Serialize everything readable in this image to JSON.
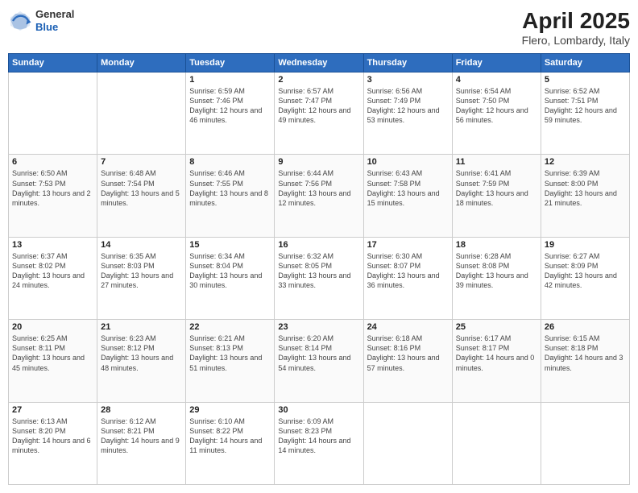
{
  "header": {
    "logo_general": "General",
    "logo_blue": "Blue",
    "title": "April 2025",
    "location": "Flero, Lombardy, Italy"
  },
  "days_of_week": [
    "Sunday",
    "Monday",
    "Tuesday",
    "Wednesday",
    "Thursday",
    "Friday",
    "Saturday"
  ],
  "weeks": [
    [
      {
        "day": null
      },
      {
        "day": null
      },
      {
        "day": "1",
        "sunrise": "Sunrise: 6:59 AM",
        "sunset": "Sunset: 7:46 PM",
        "daylight": "Daylight: 12 hours and 46 minutes."
      },
      {
        "day": "2",
        "sunrise": "Sunrise: 6:57 AM",
        "sunset": "Sunset: 7:47 PM",
        "daylight": "Daylight: 12 hours and 49 minutes."
      },
      {
        "day": "3",
        "sunrise": "Sunrise: 6:56 AM",
        "sunset": "Sunset: 7:49 PM",
        "daylight": "Daylight: 12 hours and 53 minutes."
      },
      {
        "day": "4",
        "sunrise": "Sunrise: 6:54 AM",
        "sunset": "Sunset: 7:50 PM",
        "daylight": "Daylight: 12 hours and 56 minutes."
      },
      {
        "day": "5",
        "sunrise": "Sunrise: 6:52 AM",
        "sunset": "Sunset: 7:51 PM",
        "daylight": "Daylight: 12 hours and 59 minutes."
      }
    ],
    [
      {
        "day": "6",
        "sunrise": "Sunrise: 6:50 AM",
        "sunset": "Sunset: 7:53 PM",
        "daylight": "Daylight: 13 hours and 2 minutes."
      },
      {
        "day": "7",
        "sunrise": "Sunrise: 6:48 AM",
        "sunset": "Sunset: 7:54 PM",
        "daylight": "Daylight: 13 hours and 5 minutes."
      },
      {
        "day": "8",
        "sunrise": "Sunrise: 6:46 AM",
        "sunset": "Sunset: 7:55 PM",
        "daylight": "Daylight: 13 hours and 8 minutes."
      },
      {
        "day": "9",
        "sunrise": "Sunrise: 6:44 AM",
        "sunset": "Sunset: 7:56 PM",
        "daylight": "Daylight: 13 hours and 12 minutes."
      },
      {
        "day": "10",
        "sunrise": "Sunrise: 6:43 AM",
        "sunset": "Sunset: 7:58 PM",
        "daylight": "Daylight: 13 hours and 15 minutes."
      },
      {
        "day": "11",
        "sunrise": "Sunrise: 6:41 AM",
        "sunset": "Sunset: 7:59 PM",
        "daylight": "Daylight: 13 hours and 18 minutes."
      },
      {
        "day": "12",
        "sunrise": "Sunrise: 6:39 AM",
        "sunset": "Sunset: 8:00 PM",
        "daylight": "Daylight: 13 hours and 21 minutes."
      }
    ],
    [
      {
        "day": "13",
        "sunrise": "Sunrise: 6:37 AM",
        "sunset": "Sunset: 8:02 PM",
        "daylight": "Daylight: 13 hours and 24 minutes."
      },
      {
        "day": "14",
        "sunrise": "Sunrise: 6:35 AM",
        "sunset": "Sunset: 8:03 PM",
        "daylight": "Daylight: 13 hours and 27 minutes."
      },
      {
        "day": "15",
        "sunrise": "Sunrise: 6:34 AM",
        "sunset": "Sunset: 8:04 PM",
        "daylight": "Daylight: 13 hours and 30 minutes."
      },
      {
        "day": "16",
        "sunrise": "Sunrise: 6:32 AM",
        "sunset": "Sunset: 8:05 PM",
        "daylight": "Daylight: 13 hours and 33 minutes."
      },
      {
        "day": "17",
        "sunrise": "Sunrise: 6:30 AM",
        "sunset": "Sunset: 8:07 PM",
        "daylight": "Daylight: 13 hours and 36 minutes."
      },
      {
        "day": "18",
        "sunrise": "Sunrise: 6:28 AM",
        "sunset": "Sunset: 8:08 PM",
        "daylight": "Daylight: 13 hours and 39 minutes."
      },
      {
        "day": "19",
        "sunrise": "Sunrise: 6:27 AM",
        "sunset": "Sunset: 8:09 PM",
        "daylight": "Daylight: 13 hours and 42 minutes."
      }
    ],
    [
      {
        "day": "20",
        "sunrise": "Sunrise: 6:25 AM",
        "sunset": "Sunset: 8:11 PM",
        "daylight": "Daylight: 13 hours and 45 minutes."
      },
      {
        "day": "21",
        "sunrise": "Sunrise: 6:23 AM",
        "sunset": "Sunset: 8:12 PM",
        "daylight": "Daylight: 13 hours and 48 minutes."
      },
      {
        "day": "22",
        "sunrise": "Sunrise: 6:21 AM",
        "sunset": "Sunset: 8:13 PM",
        "daylight": "Daylight: 13 hours and 51 minutes."
      },
      {
        "day": "23",
        "sunrise": "Sunrise: 6:20 AM",
        "sunset": "Sunset: 8:14 PM",
        "daylight": "Daylight: 13 hours and 54 minutes."
      },
      {
        "day": "24",
        "sunrise": "Sunrise: 6:18 AM",
        "sunset": "Sunset: 8:16 PM",
        "daylight": "Daylight: 13 hours and 57 minutes."
      },
      {
        "day": "25",
        "sunrise": "Sunrise: 6:17 AM",
        "sunset": "Sunset: 8:17 PM",
        "daylight": "Daylight: 14 hours and 0 minutes."
      },
      {
        "day": "26",
        "sunrise": "Sunrise: 6:15 AM",
        "sunset": "Sunset: 8:18 PM",
        "daylight": "Daylight: 14 hours and 3 minutes."
      }
    ],
    [
      {
        "day": "27",
        "sunrise": "Sunrise: 6:13 AM",
        "sunset": "Sunset: 8:20 PM",
        "daylight": "Daylight: 14 hours and 6 minutes."
      },
      {
        "day": "28",
        "sunrise": "Sunrise: 6:12 AM",
        "sunset": "Sunset: 8:21 PM",
        "daylight": "Daylight: 14 hours and 9 minutes."
      },
      {
        "day": "29",
        "sunrise": "Sunrise: 6:10 AM",
        "sunset": "Sunset: 8:22 PM",
        "daylight": "Daylight: 14 hours and 11 minutes."
      },
      {
        "day": "30",
        "sunrise": "Sunrise: 6:09 AM",
        "sunset": "Sunset: 8:23 PM",
        "daylight": "Daylight: 14 hours and 14 minutes."
      },
      {
        "day": null
      },
      {
        "day": null
      },
      {
        "day": null
      }
    ]
  ]
}
